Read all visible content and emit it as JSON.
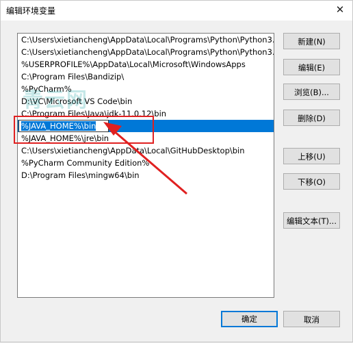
{
  "window": {
    "title": "编辑环境变量",
    "close_glyph": "✕"
  },
  "paths": [
    "C:\\Users\\xietiancheng\\AppData\\Local\\Programs\\Python\\Python3...",
    "C:\\Users\\xietiancheng\\AppData\\Local\\Programs\\Python\\Python3...",
    "%USERPROFILE%\\AppData\\Local\\Microsoft\\WindowsApps",
    "C:\\Program Files\\Bandizip\\",
    "%PyCharm%",
    "D:\\VC\\Microsoft VS Code\\bin",
    "C:\\Program Files\\Java\\jdk-11.0.12\\bin",
    "%JAVA_HOME%\\bin",
    "%JAVA_HOME%\\jre\\bin",
    "C:\\Users\\xietiancheng\\AppData\\Local\\GitHubDesktop\\bin",
    "%PyCharm Community Edition%",
    "D:\\Program Files\\mingw64\\bin"
  ],
  "selected_index": 7,
  "buttons": {
    "new": "新建(N)",
    "edit": "编辑(E)",
    "browse": "浏览(B)...",
    "delete": "删除(D)",
    "move_up": "上移(U)",
    "move_down": "下移(O)",
    "edit_text": "编辑文本(T)...",
    "ok": "确定",
    "cancel": "取消"
  },
  "watermark": "青云网",
  "colors": {
    "selection": "#0078d7",
    "annotation": "#e02020"
  }
}
